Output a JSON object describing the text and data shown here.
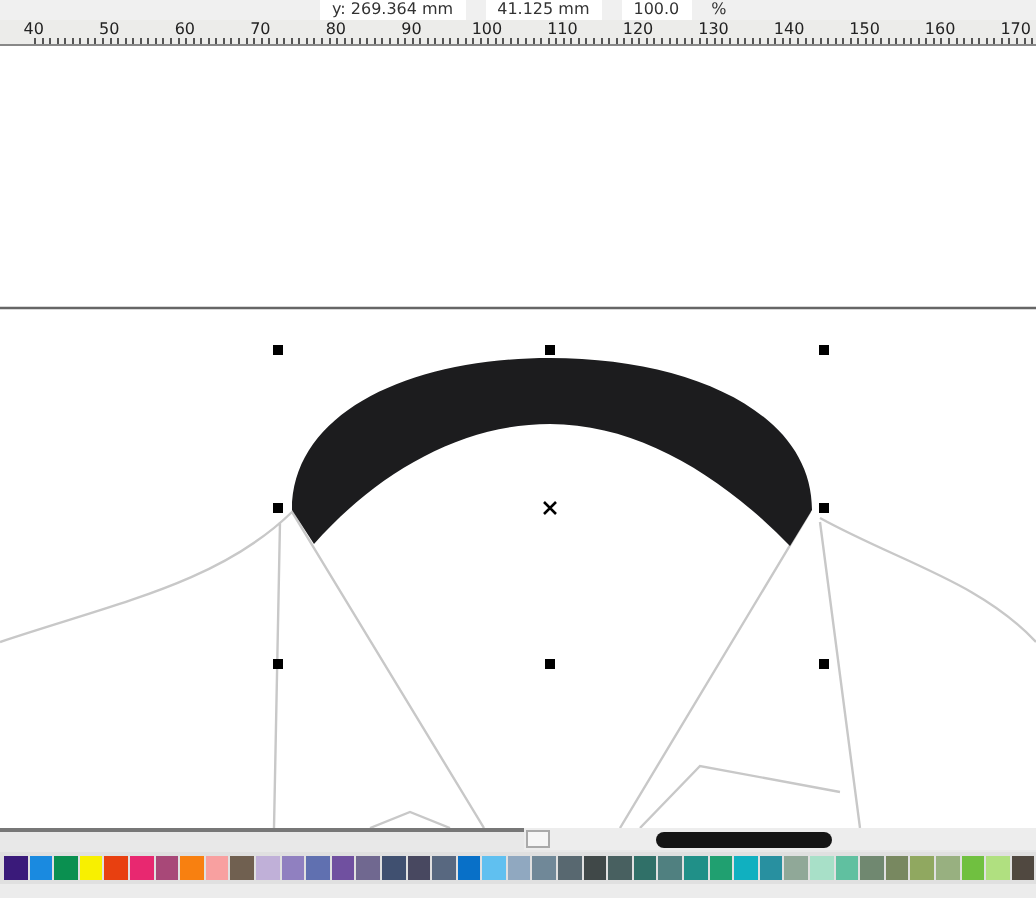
{
  "property_bar": {
    "y_field": "y: 269.364 mm",
    "height_field": "41.125 mm",
    "scale_field": "100.0",
    "scale_unit": "%"
  },
  "ruler": {
    "labels": [
      "40",
      "50",
      "60",
      "70",
      "80",
      "90",
      "100",
      "110",
      "120",
      "130",
      "140",
      "150",
      "160",
      "170"
    ]
  },
  "palette": [
    {
      "color": "#3a1a7a"
    },
    {
      "color": "#1a8ae0"
    },
    {
      "color": "#0a9050"
    },
    {
      "color": "#f8f000"
    },
    {
      "color": "#e84010"
    },
    {
      "color": "#e82870"
    },
    {
      "color": "#a84878"
    },
    {
      "color": "#f88010"
    },
    {
      "color": "#f8a0a0"
    },
    {
      "color": "#706050"
    },
    {
      "color": "#c0b0d8"
    },
    {
      "color": "#9080c0"
    },
    {
      "color": "#6070b0"
    },
    {
      "color": "#7050a0"
    },
    {
      "color": "#706890"
    },
    {
      "color": "#405070"
    },
    {
      "color": "#484860"
    },
    {
      "color": "#586880"
    },
    {
      "color": "#0870c8"
    },
    {
      "color": "#60c0f0"
    },
    {
      "color": "#90a8c0"
    },
    {
      "color": "#708898"
    },
    {
      "color": "#586870"
    },
    {
      "color": "#404848"
    },
    {
      "color": "#486060"
    },
    {
      "color": "#307068"
    },
    {
      "color": "#508080"
    },
    {
      "color": "#209088"
    },
    {
      "color": "#20a070"
    },
    {
      "color": "#10b0c0"
    },
    {
      "color": "#2890a0"
    },
    {
      "color": "#90a898"
    },
    {
      "color": "#a8e0c8"
    },
    {
      "color": "#60c0a0"
    },
    {
      "color": "#708870"
    },
    {
      "color": "#788860"
    },
    {
      "color": "#90a860"
    },
    {
      "color": "#98b080"
    },
    {
      "color": "#70c040"
    },
    {
      "color": "#b0e080"
    },
    {
      "color": "#504840"
    }
  ]
}
